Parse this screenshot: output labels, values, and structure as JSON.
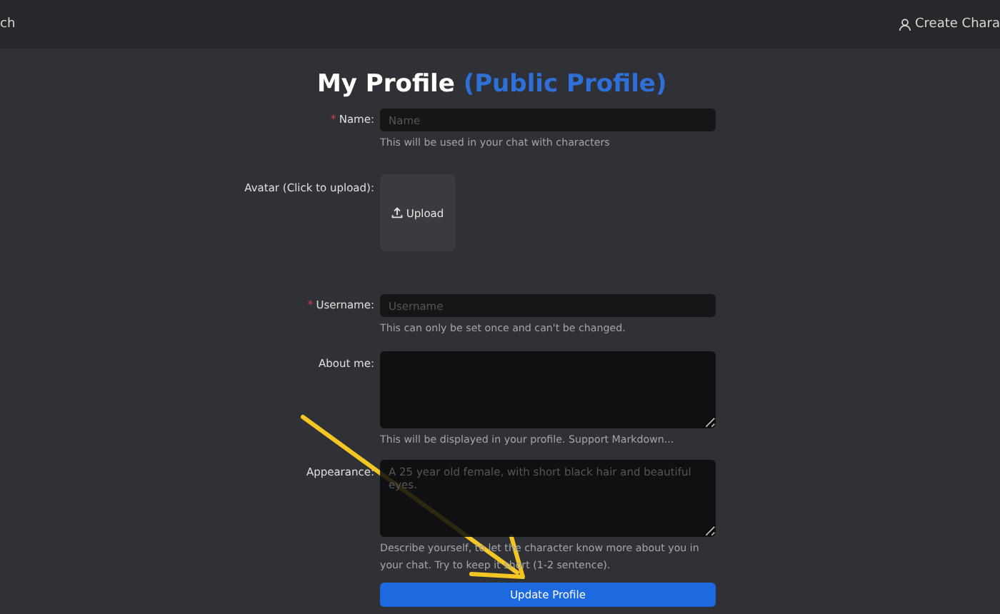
{
  "header": {
    "left_text": "ch",
    "create_link": "Create Chara"
  },
  "title": {
    "main": "My Profile",
    "accent": "(Public Profile)"
  },
  "fields": [
    {
      "kind": "input",
      "label": "Name:",
      "required_mark": "*",
      "placeholder": "Name",
      "help": "This will be used in your chat with characters"
    },
    {
      "kind": "upload",
      "label": "Avatar (Click to upload):",
      "button": "Upload"
    },
    {
      "kind": "input",
      "label": "Username:",
      "required_mark": "*",
      "placeholder": "Username",
      "help": "This can only be set once and can't be changed."
    },
    {
      "kind": "textarea",
      "label": "About me:",
      "help": "This will be displayed in your profile. Support Markdown..."
    },
    {
      "kind": "textarea",
      "label": "Appearance:",
      "placeholder": "A 25 year old female, with short black hair and beautiful eyes.",
      "help": "Describe yourself, to let the character know more about you in your chat. Try to keep it short (1-2 sentence)."
    }
  ],
  "submit": "Update Profile"
}
